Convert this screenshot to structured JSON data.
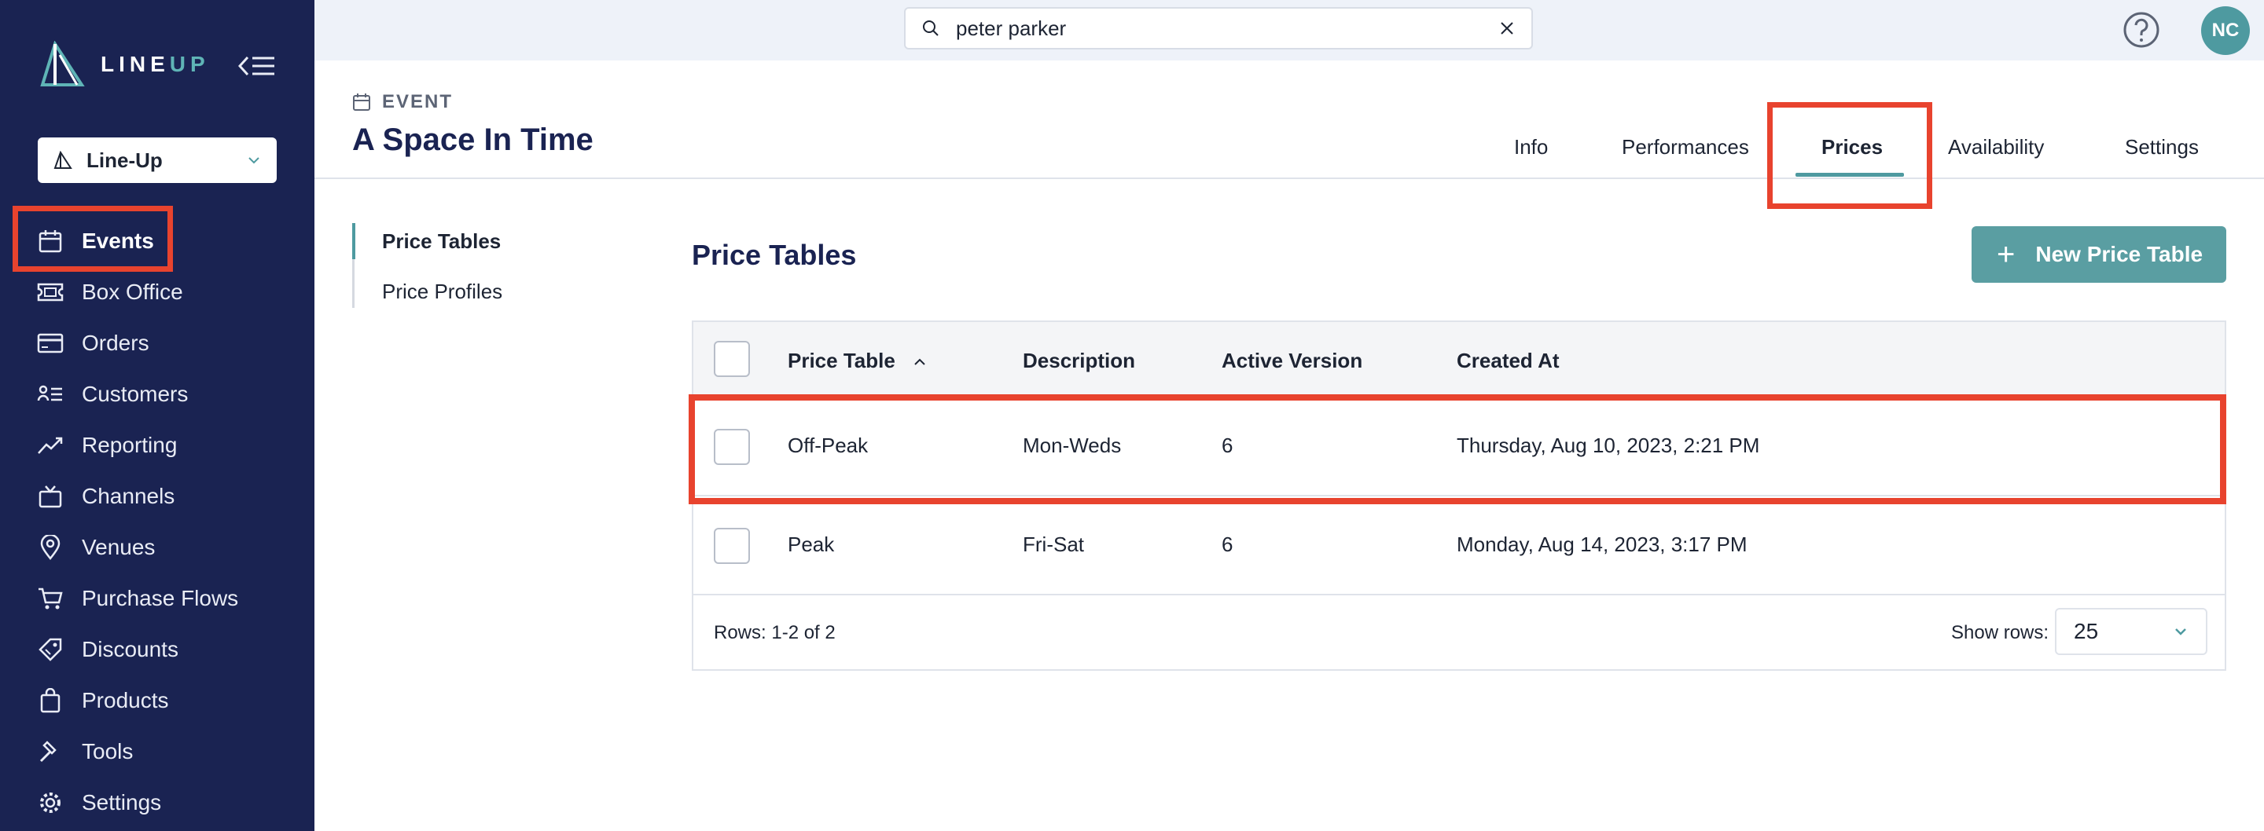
{
  "brand": {
    "name_part1": "LINE",
    "name_part2": "UP"
  },
  "org_selector": {
    "label": "Line-Up"
  },
  "sidebar": {
    "items": [
      {
        "label": "Events",
        "icon": "calendar-icon",
        "active": true
      },
      {
        "label": "Box Office",
        "icon": "ticket-icon"
      },
      {
        "label": "Orders",
        "icon": "card-icon"
      },
      {
        "label": "Customers",
        "icon": "customers-icon"
      },
      {
        "label": "Reporting",
        "icon": "chart-line-icon"
      },
      {
        "label": "Channels",
        "icon": "tv-icon"
      },
      {
        "label": "Venues",
        "icon": "map-pin-icon"
      },
      {
        "label": "Purchase Flows",
        "icon": "cart-icon"
      },
      {
        "label": "Discounts",
        "icon": "tag-icon"
      },
      {
        "label": "Products",
        "icon": "bag-icon"
      },
      {
        "label": "Tools",
        "icon": "hammer-icon"
      },
      {
        "label": "Settings",
        "icon": "gear-icon"
      }
    ]
  },
  "topbar": {
    "search_value": "peter parker",
    "avatar_initials": "NC"
  },
  "event": {
    "eyebrow": "EVENT",
    "title": "A Space In Time"
  },
  "tabs": [
    {
      "label": "Info"
    },
    {
      "label": "Performances"
    },
    {
      "label": "Prices",
      "active": true
    },
    {
      "label": "Availability"
    },
    {
      "label": "Settings"
    }
  ],
  "subnav": [
    {
      "label": "Price Tables",
      "active": true
    },
    {
      "label": "Price Profiles"
    }
  ],
  "main": {
    "title": "Price Tables",
    "new_button": "New Price Table",
    "columns": [
      "Price Table",
      "Description",
      "Active Version",
      "Created At"
    ],
    "rows": [
      {
        "name": "Off-Peak",
        "description": "Mon-Weds",
        "version": "6",
        "created": "Thursday, Aug 10, 2023, 2:21 PM"
      },
      {
        "name": "Peak",
        "description": "Fri-Sat",
        "version": "6",
        "created": "Monday, Aug 14, 2023, 3:17 PM"
      }
    ],
    "rows_count": "Rows: 1-2 of 2",
    "show_rows_label": "Show rows:",
    "show_rows_value": "25"
  },
  "colors": {
    "sidebar_bg": "#1a2352",
    "accent": "#5a9ea2",
    "highlight": "#e8432e"
  }
}
